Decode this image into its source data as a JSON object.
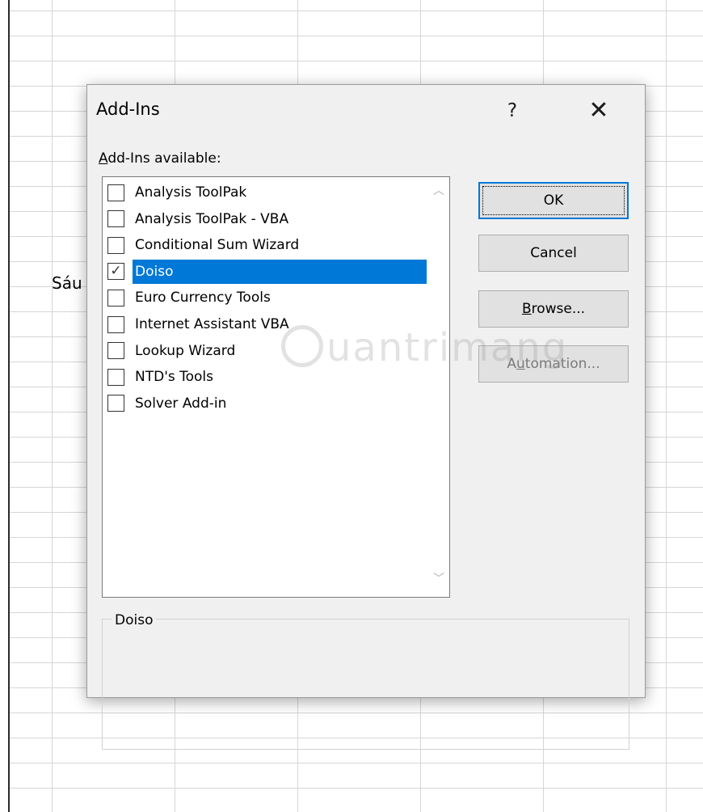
{
  "sheet": {
    "cell_text": "Sáu"
  },
  "dialog": {
    "title": "Add-Ins",
    "help_glyph": "?",
    "close_glyph": "✕",
    "available_label_prefix": "A",
    "available_label_rest": "dd-Ins available:",
    "items": [
      {
        "label": "Analysis ToolPak",
        "checked": false,
        "selected": false
      },
      {
        "label": "Analysis ToolPak - VBA",
        "checked": false,
        "selected": false
      },
      {
        "label": "Conditional Sum Wizard",
        "checked": false,
        "selected": false
      },
      {
        "label": "Doiso",
        "checked": true,
        "selected": true
      },
      {
        "label": "Euro Currency Tools",
        "checked": false,
        "selected": false
      },
      {
        "label": "Internet Assistant VBA",
        "checked": false,
        "selected": false
      },
      {
        "label": "Lookup Wizard",
        "checked": false,
        "selected": false
      },
      {
        "label": "NTD's Tools",
        "checked": false,
        "selected": false
      },
      {
        "label": "Solver Add-in",
        "checked": false,
        "selected": false
      }
    ],
    "check_glyph": "✓",
    "scroll_up_glyph": "︿",
    "scroll_down_glyph": "﹀",
    "buttons": {
      "ok": "OK",
      "cancel": "Cancel",
      "browse_prefix": "B",
      "browse_rest": "rowse...",
      "automation_prefix": "A",
      "automation_u": "u",
      "automation_rest": "tomation..."
    },
    "description_title": "Doiso",
    "description_text": ""
  },
  "watermark": {
    "text": "uantrimang"
  },
  "colors": {
    "selection": "#0078d7",
    "dialog_bg": "#f0f0f0",
    "button_bg": "#e1e1e1"
  }
}
